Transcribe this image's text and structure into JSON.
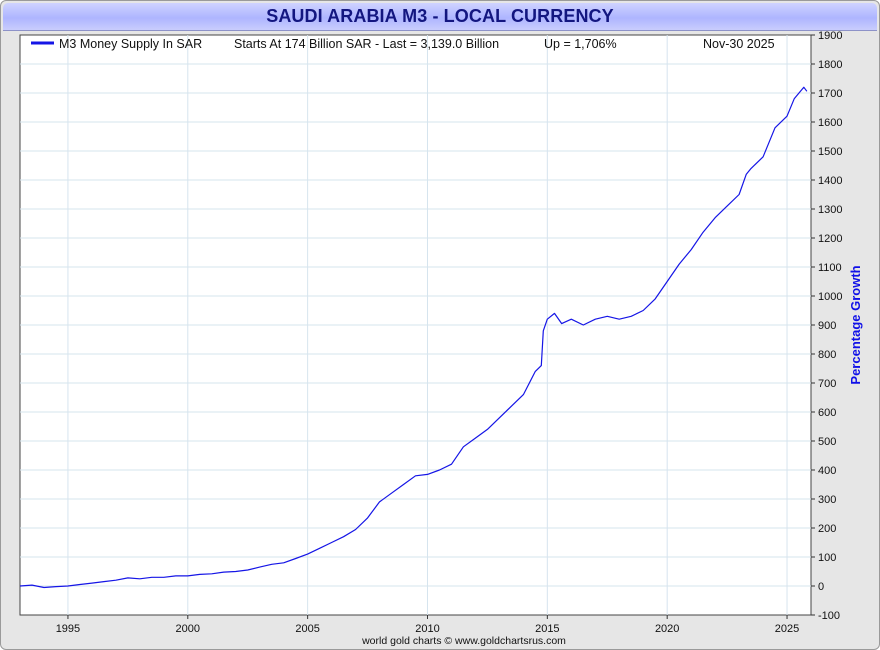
{
  "title": "SAUDI ARABIA M3 - LOCAL CURRENCY",
  "legend": {
    "series_label": "M3 Money Supply In SAR",
    "stats": "Starts At 174 Billion SAR - Last = 3,139.0 Billion",
    "up": "Up = 1,706%",
    "date": "Nov-30  2025"
  },
  "credit": "world gold charts © www.goldchartsrus.com",
  "colors": {
    "line": "#1515e6",
    "title": "#131680",
    "ylabel": "#1010e8",
    "grid": "#d6e4ee"
  },
  "chart_data": {
    "type": "line",
    "title": "SAUDI ARABIA M3 - LOCAL CURRENCY",
    "xlabel": "",
    "ylabel": "Percentage Growth",
    "xlim": [
      1993.0,
      2026.0
    ],
    "ylim": [
      -100,
      1900
    ],
    "x_ticks": [
      1995,
      2000,
      2005,
      2010,
      2015,
      2020,
      2025
    ],
    "y_ticks": [
      -100,
      0,
      100,
      200,
      300,
      400,
      500,
      600,
      700,
      800,
      900,
      1000,
      1100,
      1200,
      1300,
      1400,
      1500,
      1600,
      1700,
      1800,
      1900
    ],
    "grid": true,
    "legend_position": "top",
    "series": [
      {
        "name": "M3 Money Supply In SAR",
        "x": [
          1993.0,
          1993.5,
          1994.0,
          1994.5,
          1995.0,
          1995.5,
          1996.0,
          1996.5,
          1997.0,
          1997.5,
          1998.0,
          1998.5,
          1999.0,
          1999.5,
          2000.0,
          2000.5,
          2001.0,
          2001.5,
          2002.0,
          2002.5,
          2003.0,
          2003.5,
          2004.0,
          2004.5,
          2005.0,
          2005.5,
          2006.0,
          2006.5,
          2007.0,
          2007.5,
          2008.0,
          2008.5,
          2009.0,
          2009.5,
          2010.0,
          2010.5,
          2011.0,
          2011.5,
          2012.0,
          2012.5,
          2013.0,
          2013.5,
          2014.0,
          2014.5,
          2014.75,
          2014.83,
          2015.0,
          2015.3,
          2015.6,
          2016.0,
          2016.5,
          2017.0,
          2017.5,
          2018.0,
          2018.5,
          2019.0,
          2019.5,
          2020.0,
          2020.5,
          2021.0,
          2021.5,
          2022.0,
          2022.5,
          2023.0,
          2023.3,
          2023.5,
          2024.0,
          2024.5,
          2025.0,
          2025.3,
          2025.5,
          2025.7,
          2025.83
        ],
        "values": [
          0,
          3,
          -5,
          -2,
          0,
          5,
          10,
          15,
          20,
          28,
          25,
          30,
          30,
          35,
          35,
          40,
          42,
          48,
          50,
          55,
          65,
          75,
          80,
          95,
          110,
          130,
          150,
          170,
          195,
          235,
          290,
          320,
          350,
          380,
          385,
          400,
          420,
          480,
          510,
          540,
          580,
          620,
          660,
          740,
          760,
          880,
          920,
          940,
          905,
          920,
          900,
          920,
          930,
          920,
          930,
          950,
          990,
          1050,
          1110,
          1160,
          1220,
          1270,
          1310,
          1350,
          1420,
          1440,
          1480,
          1580,
          1620,
          1680,
          1700,
          1720,
          1706
        ]
      }
    ]
  }
}
